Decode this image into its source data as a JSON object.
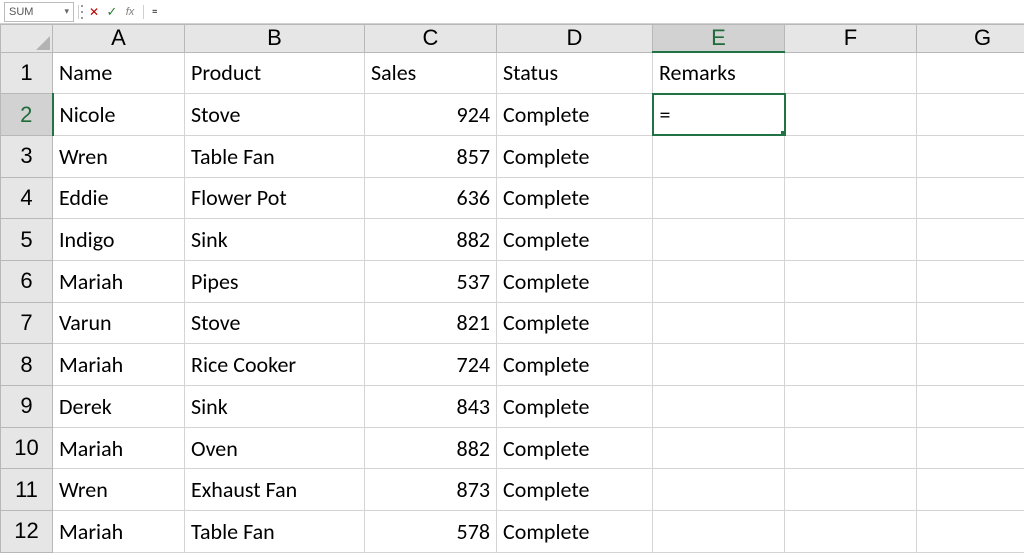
{
  "formulaBar": {
    "nameBox": "SUM",
    "cancel": "✕",
    "enter": "✓",
    "fx": "fx",
    "formula": "="
  },
  "columns": [
    "A",
    "B",
    "C",
    "D",
    "E",
    "F",
    "G"
  ],
  "rowNumbers": [
    1,
    2,
    3,
    4,
    5,
    6,
    7,
    8,
    9,
    10,
    11,
    12
  ],
  "activeCol": "E",
  "activeRowIndex": 1,
  "headers": {
    "A": "Name",
    "B": "Product",
    "C": "Sales",
    "D": "Status",
    "E": "Remarks"
  },
  "rows": [
    {
      "A": "Nicole",
      "B": "Stove",
      "C": 924,
      "D": "Complete",
      "E": "="
    },
    {
      "A": "Wren",
      "B": "Table Fan",
      "C": 857,
      "D": "Complete",
      "E": ""
    },
    {
      "A": "Eddie",
      "B": "Flower Pot",
      "C": 636,
      "D": "Complete",
      "E": ""
    },
    {
      "A": "Indigo",
      "B": "Sink",
      "C": 882,
      "D": "Complete",
      "E": ""
    },
    {
      "A": "Mariah",
      "B": "Pipes",
      "C": 537,
      "D": "Complete",
      "E": ""
    },
    {
      "A": "Varun",
      "B": "Stove",
      "C": 821,
      "D": "Complete",
      "E": ""
    },
    {
      "A": "Mariah",
      "B": "Rice Cooker",
      "C": 724,
      "D": "Complete",
      "E": ""
    },
    {
      "A": "Derek",
      "B": "Sink",
      "C": 843,
      "D": "Complete",
      "E": ""
    },
    {
      "A": "Mariah",
      "B": "Oven",
      "C": 882,
      "D": "Complete",
      "E": ""
    },
    {
      "A": "Wren",
      "B": "Exhaust Fan",
      "C": 873,
      "D": "Complete",
      "E": ""
    },
    {
      "A": "Mariah",
      "B": "Table Fan",
      "C": 578,
      "D": "Complete",
      "E": ""
    }
  ],
  "chart_data": {
    "type": "table",
    "headers": [
      "Name",
      "Product",
      "Sales",
      "Status",
      "Remarks"
    ],
    "rows": [
      [
        "Nicole",
        "Stove",
        924,
        "Complete",
        "="
      ],
      [
        "Wren",
        "Table Fan",
        857,
        "Complete",
        ""
      ],
      [
        "Eddie",
        "Flower Pot",
        636,
        "Complete",
        ""
      ],
      [
        "Indigo",
        "Sink",
        882,
        "Complete",
        ""
      ],
      [
        "Mariah",
        "Pipes",
        537,
        "Complete",
        ""
      ],
      [
        "Varun",
        "Stove",
        821,
        "Complete",
        ""
      ],
      [
        "Mariah",
        "Rice Cooker",
        724,
        "Complete",
        ""
      ],
      [
        "Derek",
        "Sink",
        843,
        "Complete",
        ""
      ],
      [
        "Mariah",
        "Oven",
        882,
        "Complete",
        ""
      ],
      [
        "Wren",
        "Exhaust Fan",
        873,
        "Complete",
        ""
      ],
      [
        "Mariah",
        "Table Fan",
        578,
        "Complete",
        ""
      ]
    ]
  }
}
